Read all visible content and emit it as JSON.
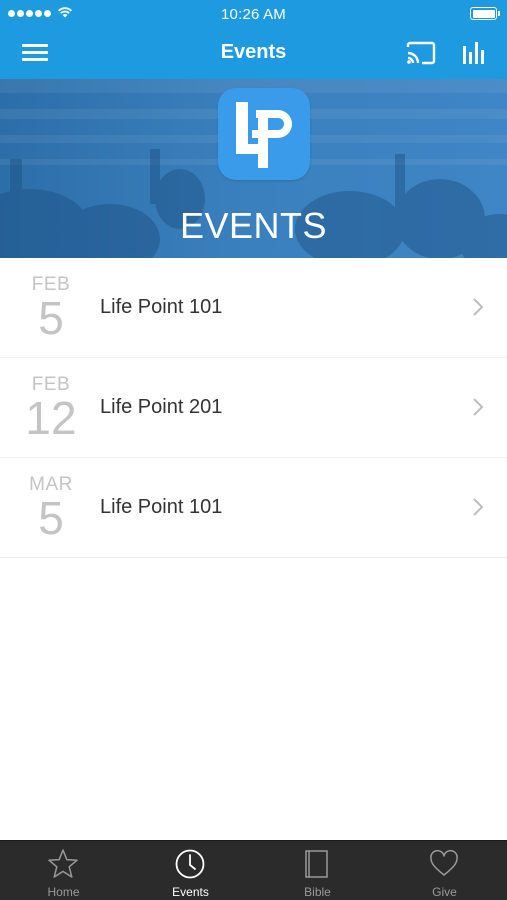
{
  "status_bar": {
    "time": "10:26 AM"
  },
  "nav": {
    "title": "Events"
  },
  "hero": {
    "title": "EVENTS"
  },
  "events": [
    {
      "month": "FEB",
      "day": "5",
      "name": "Life Point 101"
    },
    {
      "month": "FEB",
      "day": "12",
      "name": "Life Point 201"
    },
    {
      "month": "MAR",
      "day": "5",
      "name": "Life Point 101"
    }
  ],
  "tabs": [
    {
      "label": "Home",
      "icon": "star-icon",
      "active": false
    },
    {
      "label": "Events",
      "icon": "clock-icon",
      "active": true
    },
    {
      "label": "Bible",
      "icon": "book-icon",
      "active": false
    },
    {
      "label": "Give",
      "icon": "heart-icon",
      "active": false
    }
  ],
  "colors": {
    "brand_blue": "#1e9be0",
    "logo_blue": "#3a9bea",
    "tab_bar": "#2b2b2b"
  }
}
